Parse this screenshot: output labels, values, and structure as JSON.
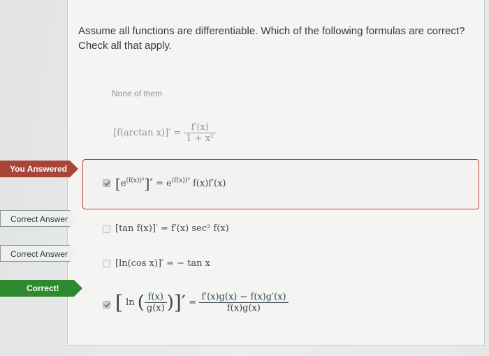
{
  "question": {
    "line1": "Assume all functions are differentiable. Which of the following formulas are correct?",
    "line2": "Check all that apply."
  },
  "flags": {
    "you_answered": "You Answered",
    "correct_answer_1": "Correct Answer",
    "correct_answer_2": "Correct Answer",
    "correct": "Correct!"
  },
  "options": {
    "none": "None of them",
    "opt1": {
      "lhs": "[f(arctan x)]′ =",
      "num": "f′(x)",
      "den": "1 + x²"
    },
    "opt2": {
      "lhs": "[e",
      "exp": "(f(x))²",
      "mid": "]′ = e",
      "exp2": "(f(x))²",
      "rhs": " f(x)f′(x)"
    },
    "opt3": {
      "text": "[tan f(x)]′ = f′(x) sec² f(x)"
    },
    "opt4": {
      "text": "[ln(cos x)]′ = − tan x"
    },
    "opt5": {
      "lhs": "ln",
      "inner_num": "f(x)",
      "inner_den": "g(x)",
      "num": "f′(x)g(x) − f(x)g′(x)",
      "den": "f(x)g(x)"
    }
  },
  "states": {
    "opt2_checked": true,
    "opt3_checked": false,
    "opt4_checked": false,
    "opt5_checked": true
  }
}
